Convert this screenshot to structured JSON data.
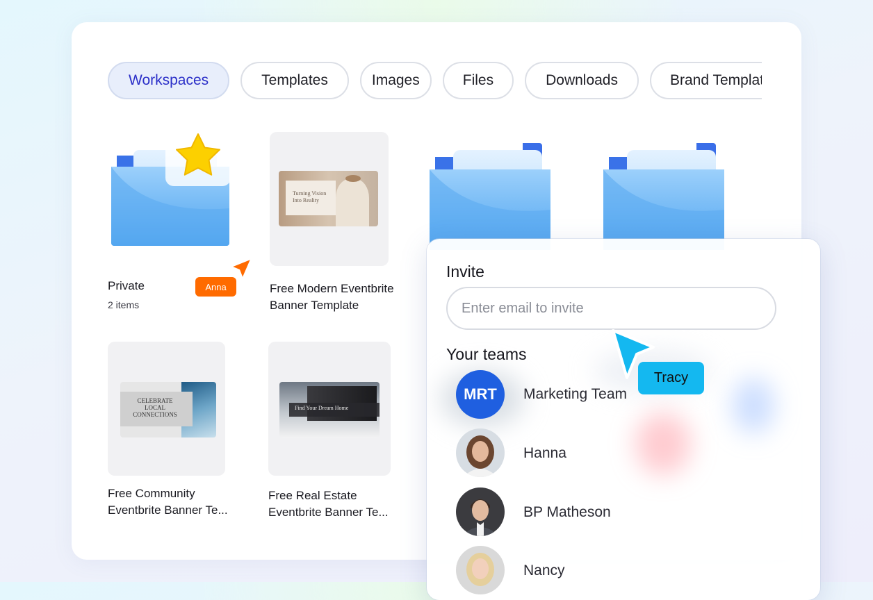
{
  "tabs": [
    {
      "label": "Workspaces",
      "active": true
    },
    {
      "label": "Templates",
      "active": false
    },
    {
      "label": "Images",
      "active": false
    },
    {
      "label": "Files",
      "active": false
    },
    {
      "label": "Downloads",
      "active": false
    },
    {
      "label": "Brand Templates",
      "active": false
    }
  ],
  "items": [
    {
      "title": "Private",
      "subtitle": "2 items",
      "icon": "star-folder-icon"
    },
    {
      "title_line1": "Free Modern Eventbrite",
      "title_line2": "Banner Template",
      "thumb_text": "Turning Vision Into Reality"
    },
    {
      "icon": "folder-icon"
    },
    {
      "icon": "folder-icon"
    },
    {
      "title_line1": "Free Community",
      "title_line2": "Eventbrite Banner Te...",
      "thumb_text": "CELEBRATE LOCAL CONNECTIONS"
    },
    {
      "title_line1": "Free Real Estate",
      "title_line2": "Eventbrite Banner Te...",
      "thumb_text": "Find Your Dream Home"
    }
  ],
  "cursors": [
    {
      "name": "Anna",
      "color": "#ff6b00"
    },
    {
      "name": "Tracy",
      "color": "#14b8f0"
    }
  ],
  "invite": {
    "title": "Invite",
    "placeholder": "Enter email to invite",
    "teams_title": "Your teams",
    "members": [
      {
        "name": "Marketing Team",
        "initials": "MRT"
      },
      {
        "name": "Hanna"
      },
      {
        "name": "BP Matheson"
      },
      {
        "name": "Nancy"
      }
    ]
  },
  "colors": {
    "accent": "#2b2fc8",
    "folder_blue": "#5aa9f0",
    "team_avatar": "#1f5fe0"
  }
}
